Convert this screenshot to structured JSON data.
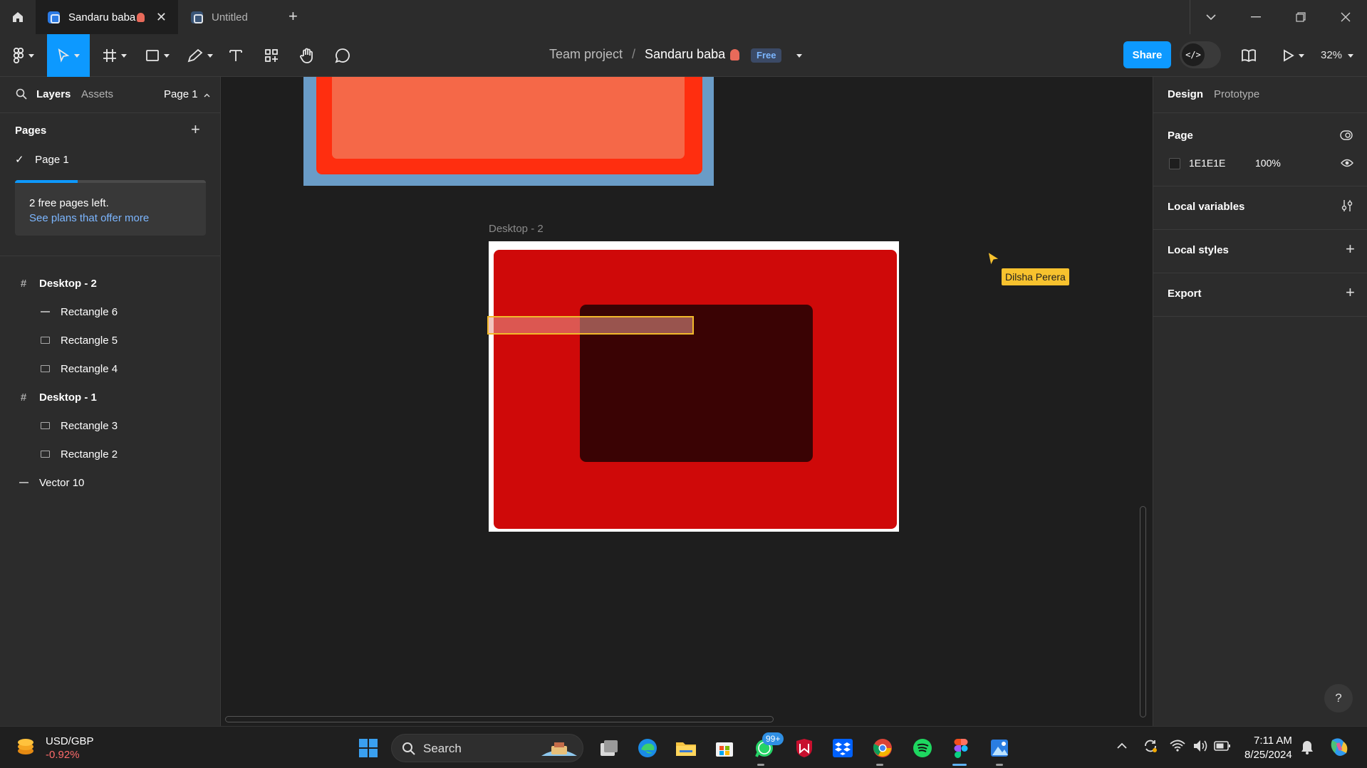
{
  "tabs": [
    {
      "title": "Sandaru baba",
      "active": true
    },
    {
      "title": "Untitled",
      "active": false
    }
  ],
  "breadcrumb": {
    "team": "Team project",
    "separator": "/",
    "file": "Sandaru baba",
    "plan_badge": "Free"
  },
  "toolbar": {
    "share_label": "Share",
    "zoom": "32%",
    "dev_mode_icon": "</>"
  },
  "left_panel": {
    "tab_layers": "Layers",
    "tab_assets": "Assets",
    "page_select": "Page 1",
    "pages_title": "Pages",
    "pages": [
      {
        "name": "Page 1",
        "selected": true
      }
    ],
    "free_pages_text": "2 free pages left.",
    "free_pages_link": "See plans that offer more",
    "free_pages_progress": 0.33,
    "layers": [
      {
        "name": "Desktop - 2",
        "type": "frame",
        "depth": 0
      },
      {
        "name": "Rectangle 6",
        "type": "line",
        "depth": 1
      },
      {
        "name": "Rectangle 5",
        "type": "rect",
        "depth": 1
      },
      {
        "name": "Rectangle 4",
        "type": "rect",
        "depth": 1
      },
      {
        "name": "Desktop - 1",
        "type": "frame",
        "depth": 0
      },
      {
        "name": "Rectangle 3",
        "type": "rect",
        "depth": 1
      },
      {
        "name": "Rectangle 2",
        "type": "rect",
        "depth": 1
      },
      {
        "name": "Vector 10",
        "type": "line",
        "depth": 0
      }
    ]
  },
  "canvas": {
    "frame_label": "Desktop - 2",
    "collaborator_name": "Dilsha Perera",
    "colors": {
      "frame1_bg": "#6a9cc7",
      "frame1_mid": "#ff2e0f",
      "frame1_inner": "#f56848",
      "frame2_red": "#cf0909",
      "frame2_dark": "#3a0304",
      "selection": "#f2b92a",
      "cursor": "#f7c22e"
    }
  },
  "right_panel": {
    "tab_design": "Design",
    "tab_prototype": "Prototype",
    "page_section": "Page",
    "page_color": "1E1E1E",
    "page_opacity": "100%",
    "local_variables": "Local variables",
    "local_styles": "Local styles",
    "export": "Export",
    "help": "?"
  },
  "taskbar": {
    "stock_symbol": "USD/GBP",
    "stock_change": "-0.92%",
    "search_placeholder": "Search",
    "whatsapp_badge": "99+",
    "time": "7:11 AM",
    "date": "8/25/2024"
  }
}
